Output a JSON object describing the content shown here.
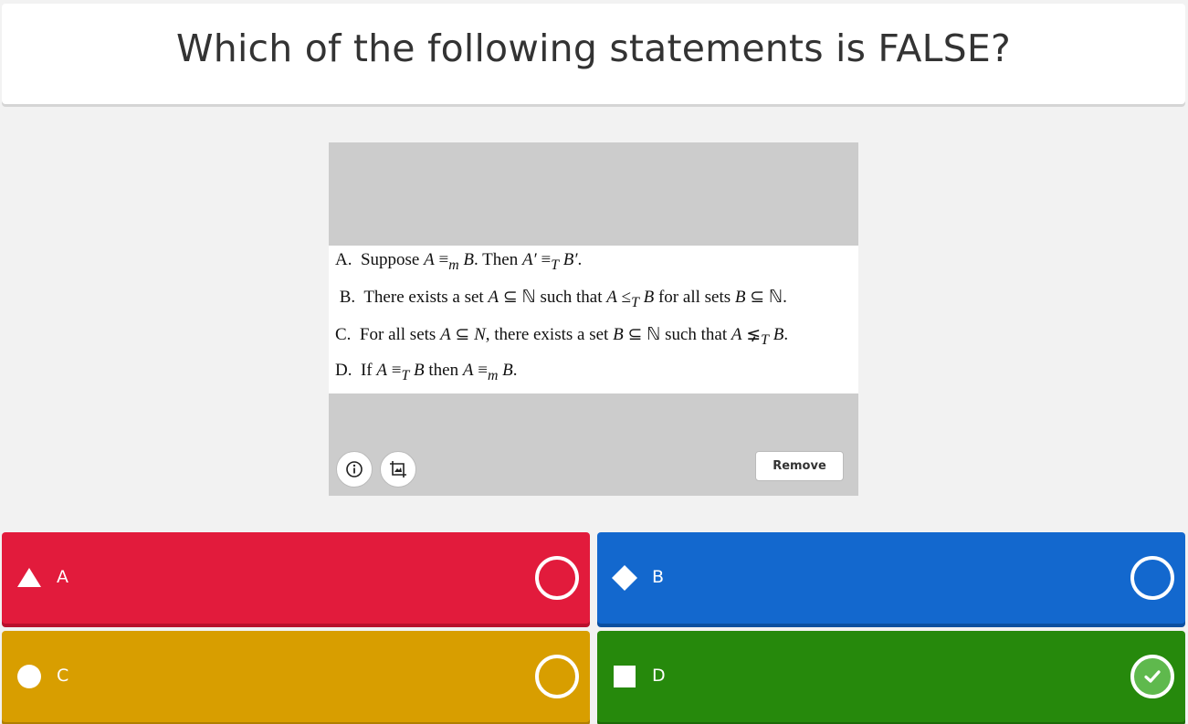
{
  "question": {
    "text": "Which of the following statements is FALSE?"
  },
  "media": {
    "info_icon": "info-icon",
    "crop_icon": "crop-image-icon",
    "remove_label": "Remove",
    "statements": [
      {
        "letter": "A.",
        "pre": "Suppose ",
        "mid1": "A",
        "rel1": " ≡",
        "sub1": "m",
        "rest1": " B",
        "post": ". Then ",
        "expr": "A′ ≡",
        "sub2": "T",
        "end": " B′."
      },
      {
        "text": "B.  There exists a set A ⊆ ℕ such that A ≤T B for all sets B ⊆ ℕ."
      },
      {
        "text": "C.  For all sets A ⊆ N, there exists a set B ⊆ ℕ such that A ⪇T B."
      },
      {
        "text": "D.  If A ≡T B then A ≡m B."
      }
    ]
  },
  "answers": [
    {
      "label": "A",
      "color": "#e21b3c",
      "shape": "triangle-icon",
      "correct": false
    },
    {
      "label": "B",
      "color": "#1368ce",
      "shape": "diamond-icon",
      "correct": false
    },
    {
      "label": "C",
      "color": "#d89e00",
      "shape": "circle-icon",
      "correct": false
    },
    {
      "label": "D",
      "color": "#26890c",
      "shape": "square-icon",
      "correct": true
    }
  ],
  "colors": {
    "background": "#f2f2f2",
    "correct_check": "#5fb94d"
  }
}
